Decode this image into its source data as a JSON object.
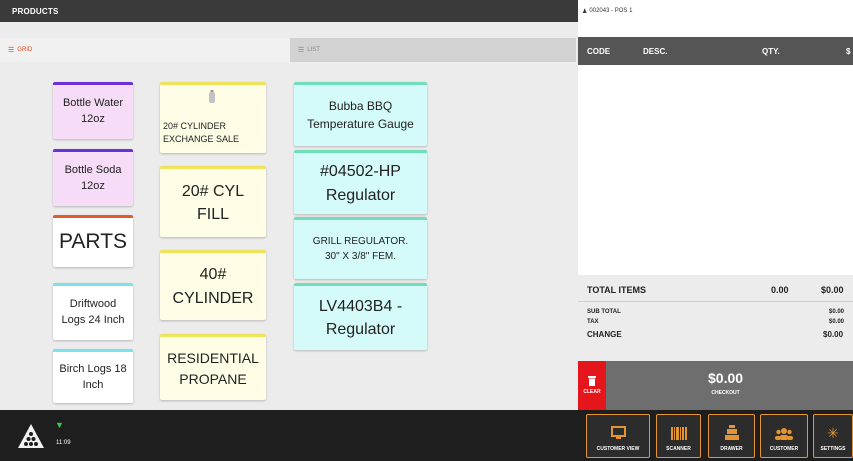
{
  "products": {
    "header": "PRODUCTS",
    "tab_grid": "GRID",
    "tab_list": "LIST"
  },
  "tiles": {
    "bottle_water": [
      "Bottle Water",
      "12oz"
    ],
    "bottle_soda": [
      "Bottle Soda",
      "12oz"
    ],
    "parts": [
      "PARTS"
    ],
    "driftwood": [
      "Driftwood",
      "Logs 24 Inch"
    ],
    "birch": [
      "Birch Logs 18",
      "Inch"
    ],
    "exchange": [
      "20# CYLINDER",
      "EXCHANGE SALE"
    ],
    "cyl_fill": [
      "20# CYL",
      "FILL"
    ],
    "cylinder": [
      "40#",
      "CYLINDER"
    ],
    "residential": [
      "RESIDENTIAL",
      "PROPANE"
    ],
    "bubba": [
      "Bubba BBQ",
      "Temperature Gauge"
    ],
    "reg04502": [
      "#04502-HP",
      "Regulator"
    ],
    "grill": [
      "GRILL REGULATOR.",
      "30\" X 3/8\" FEM."
    ],
    "lv4403": [
      "LV4403B4 -",
      "Regulator"
    ]
  },
  "order": {
    "title": "002043 - POS 1",
    "col_code": "CODE",
    "col_desc": "DESC.",
    "col_qty": "QTY.",
    "col_price": "$",
    "total_items_label": "TOTAL ITEMS",
    "total_items_qty": "0.00",
    "total_items_value": "$0.00",
    "subtotal_label": "SUB TOTAL",
    "subtotal_value": "$0.00",
    "tax_label": "TAX",
    "tax_value": "$0.00",
    "change_label": "CHANGE",
    "change_value": "$0.00",
    "clear_label": "CLEAR",
    "checkout_amount": "$0.00",
    "checkout_label": "CHECKOUT"
  },
  "footer": {
    "time": "11:09",
    "buttons": {
      "customer_view": "CUSTOMER VIEW",
      "scanner": "SCANNER",
      "drawer": "DRAWER",
      "customer": "CUSTOMER",
      "settings": "SETTINGS"
    }
  },
  "colors": {
    "accent_orange": "#e49431",
    "clear_red": "#e4161b",
    "wifi_green": "#2fd14c"
  }
}
